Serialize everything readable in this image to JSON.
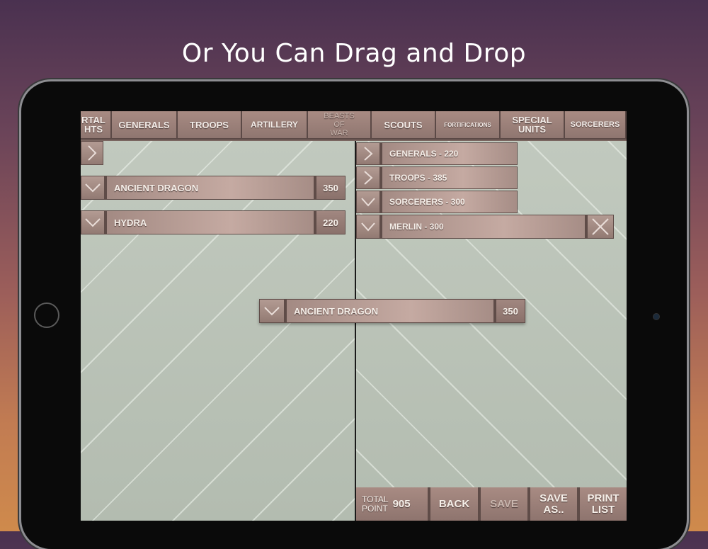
{
  "headline": "Or You Can Drag and Drop",
  "tabs": [
    {
      "label": "RTAL\nHTS",
      "id": "immortal-knights"
    },
    {
      "label": "GENERALS"
    },
    {
      "label": "TROOPS"
    },
    {
      "label": "ARTILLERY"
    },
    {
      "label": "BEASTS\nOF\nWAR"
    },
    {
      "label": "SCOUTS"
    },
    {
      "label": "FORTIFICATIONS"
    },
    {
      "label": "SPECIAL\nUNITS"
    },
    {
      "label": "SORCERERS"
    }
  ],
  "left_list": [
    {
      "name": "ANCIENT DRAGON",
      "points": "350"
    },
    {
      "name": "HYDRA",
      "points": "220"
    }
  ],
  "dragging_item": {
    "name": "ANCIENT DRAGON",
    "points": "350"
  },
  "right_list": {
    "groups": [
      {
        "label": "GENERALS - 220",
        "expanded": false
      },
      {
        "label": "TROOPS - 385",
        "expanded": false
      },
      {
        "label": "SORCERERS - 300",
        "expanded": true
      }
    ],
    "entries": [
      {
        "label": "MERLIN - 300"
      }
    ]
  },
  "bottom": {
    "total_label_1": "TOTAL",
    "total_label_2": "POINT",
    "total_value": "905",
    "back": "BACK",
    "save": "SAVE",
    "save_as": "SAVE\nAS..",
    "print_list": "PRINT\nLIST"
  },
  "colors": {
    "accent": "#a88b83",
    "panel": "#b7c0b4"
  }
}
